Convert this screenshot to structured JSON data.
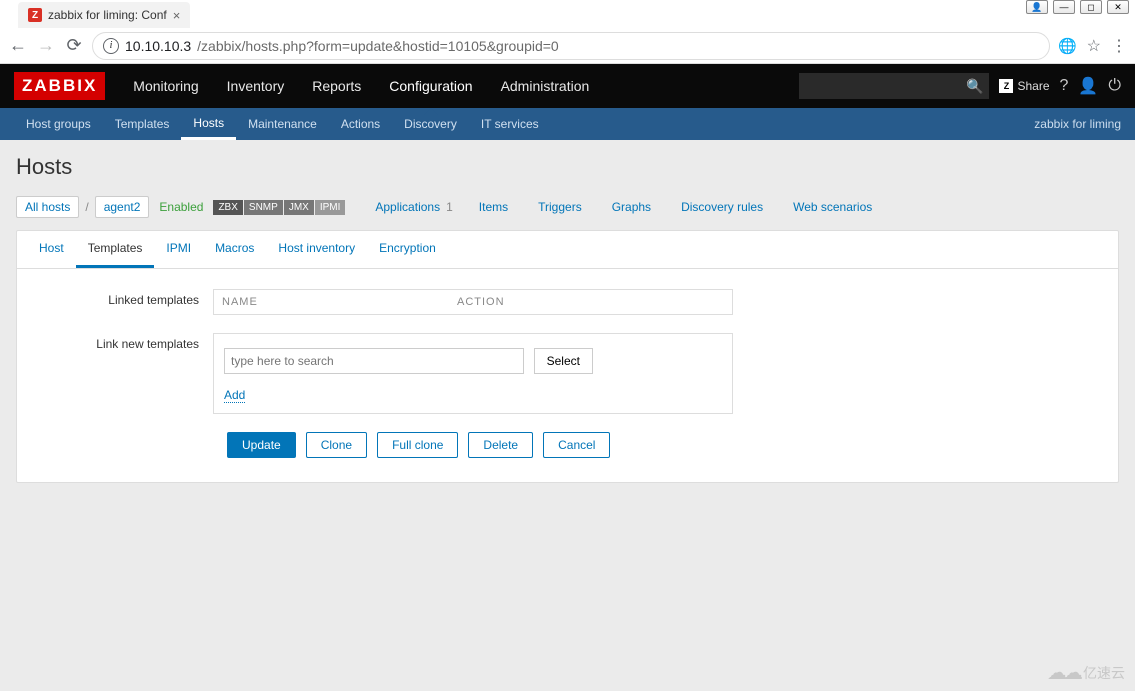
{
  "window": {
    "tab_title": "zabbix for liming: Conf",
    "favicon_letter": "Z"
  },
  "browser": {
    "url_host": "10.10.10.3",
    "url_path": "/zabbix/hosts.php?form=update&hostid=10105&groupid=0"
  },
  "header": {
    "logo": "ZABBIX",
    "nav": [
      "Monitoring",
      "Inventory",
      "Reports",
      "Configuration",
      "Administration"
    ],
    "active_nav_index": 3,
    "share_label": "Share",
    "share_badge": "Z"
  },
  "subnav": {
    "items": [
      "Host groups",
      "Templates",
      "Hosts",
      "Maintenance",
      "Actions",
      "Discovery",
      "IT services"
    ],
    "active_index": 2,
    "right_text": "zabbix for liming"
  },
  "page": {
    "title": "Hosts",
    "breadcrumb": {
      "all_hosts": "All hosts",
      "host_name": "agent2",
      "status": "Enabled",
      "badges": [
        "ZBX",
        "SNMP",
        "JMX",
        "IPMI"
      ],
      "links": [
        {
          "label": "Applications",
          "count": "1"
        },
        {
          "label": "Items",
          "count": ""
        },
        {
          "label": "Triggers",
          "count": ""
        },
        {
          "label": "Graphs",
          "count": ""
        },
        {
          "label": "Discovery rules",
          "count": ""
        },
        {
          "label": "Web scenarios",
          "count": ""
        }
      ]
    }
  },
  "form": {
    "tabs": [
      "Host",
      "Templates",
      "IPMI",
      "Macros",
      "Host inventory",
      "Encryption"
    ],
    "active_tab_index": 1,
    "linked_label": "Linked templates",
    "table_headers": {
      "name": "NAME",
      "action": "ACTION"
    },
    "link_new_label": "Link new templates",
    "search_placeholder": "type here to search",
    "select_btn": "Select",
    "add_link": "Add",
    "buttons": {
      "update": "Update",
      "clone": "Clone",
      "full_clone": "Full clone",
      "delete": "Delete",
      "cancel": "Cancel"
    }
  },
  "watermark": "亿速云"
}
